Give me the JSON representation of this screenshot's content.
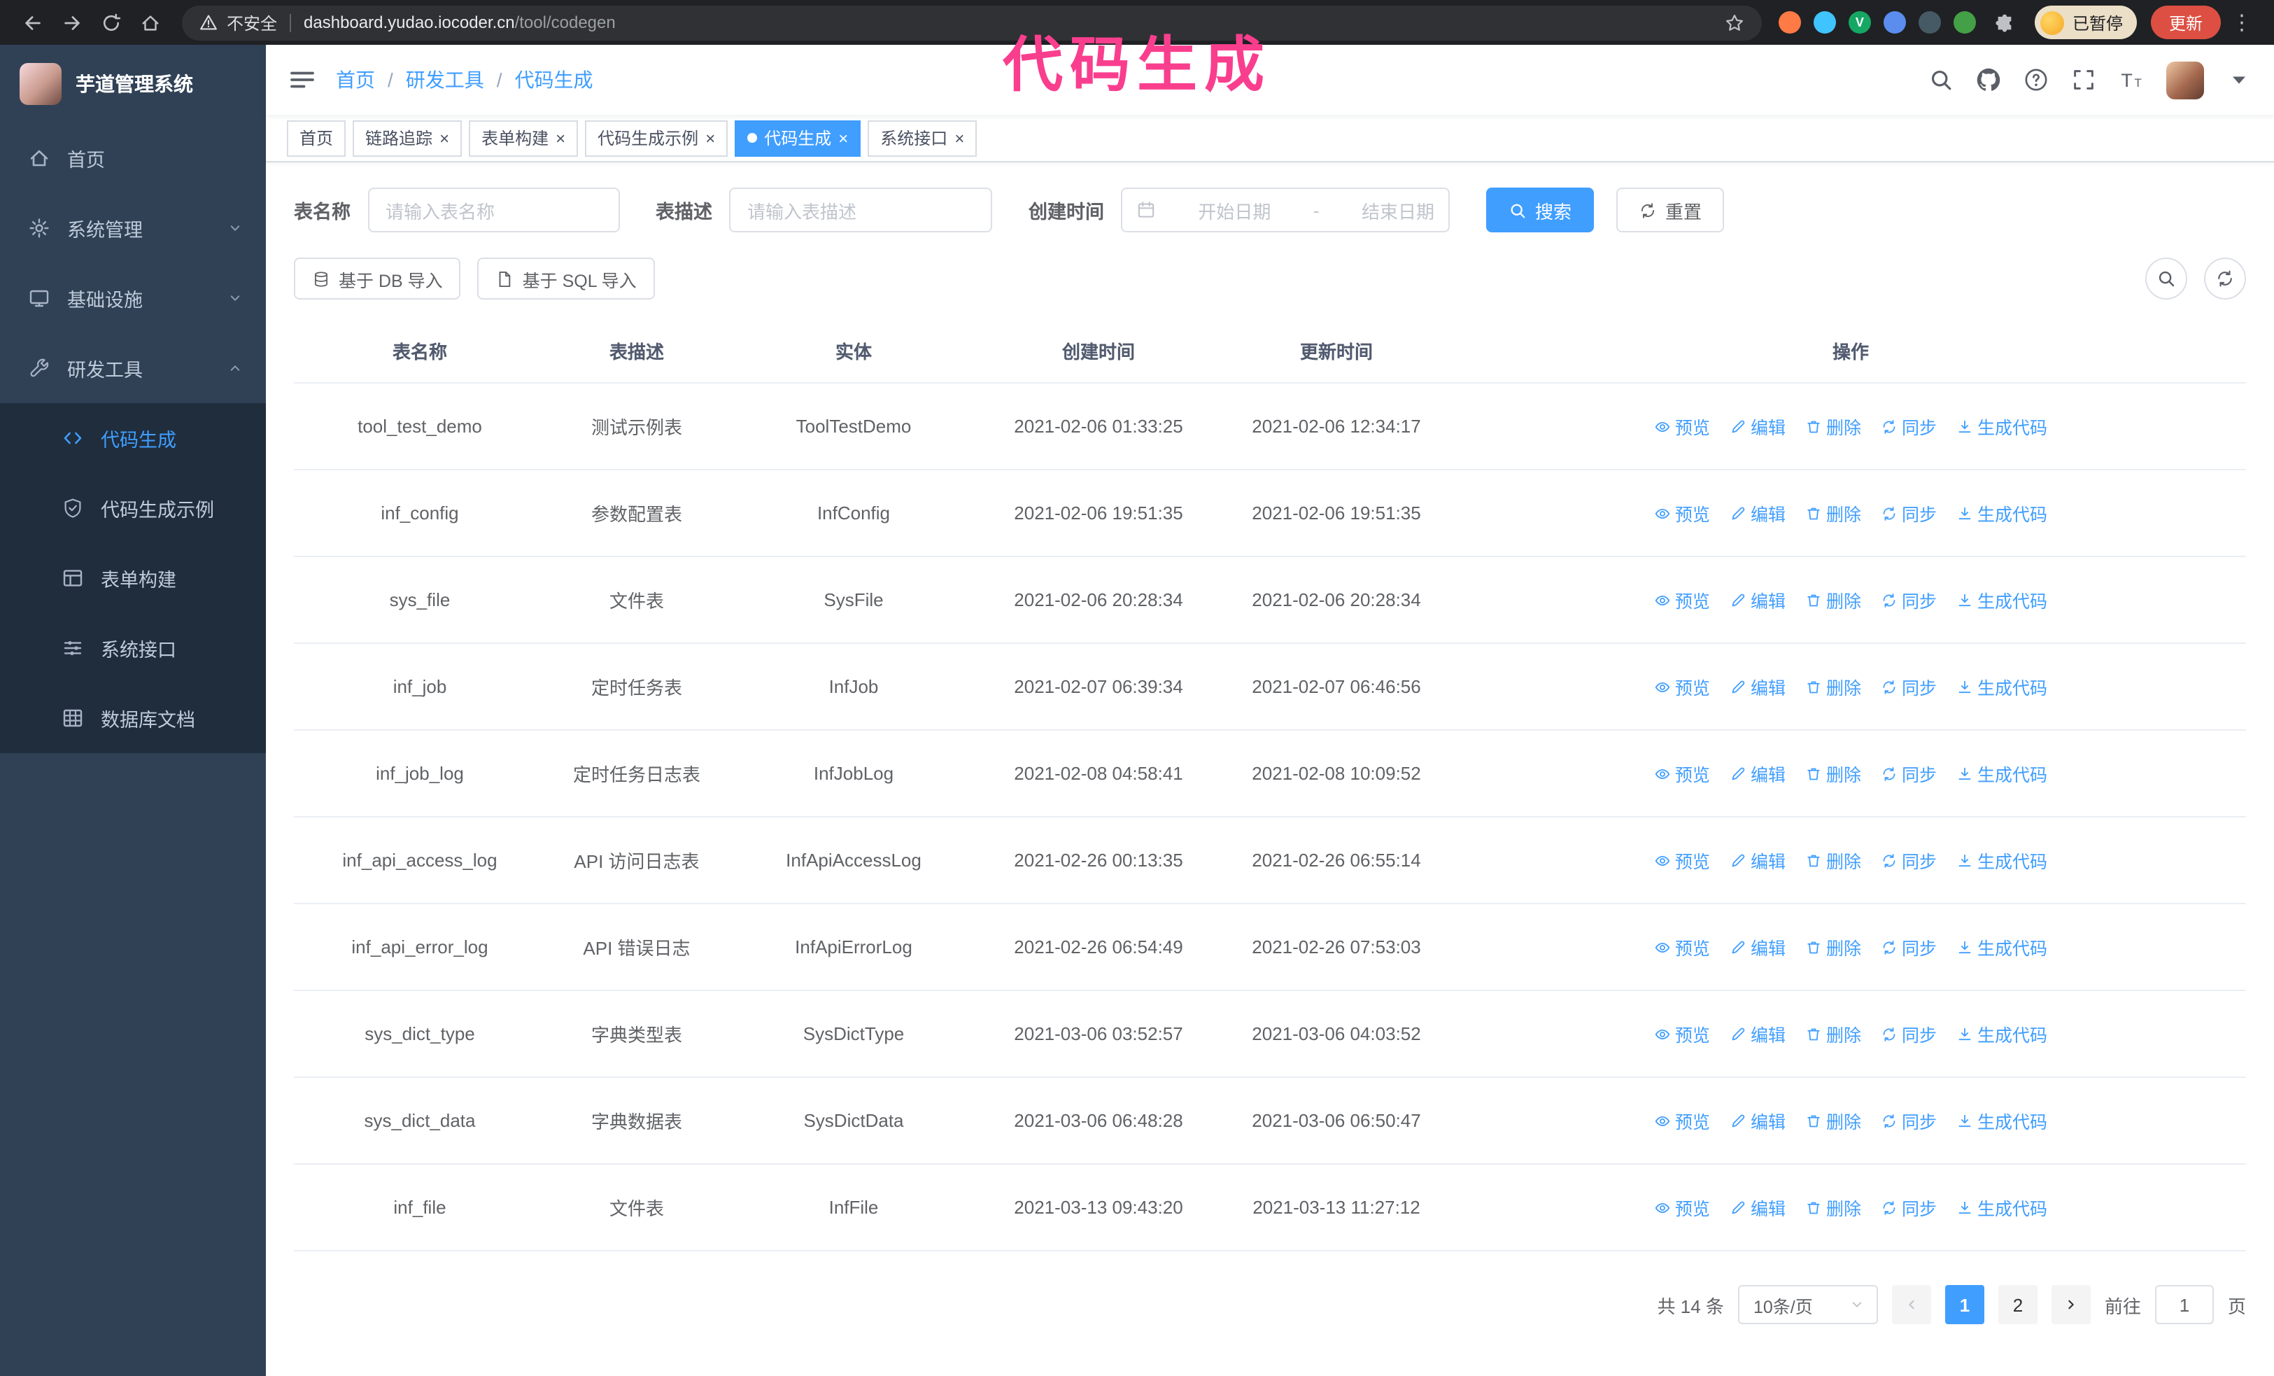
{
  "annotation": {
    "text": "代码生成",
    "color": "#fa3e8e"
  },
  "browser": {
    "security_label": "不安全",
    "url_host": "dashboard.yudao.iocoder.cn",
    "url_path": "/tool/codegen",
    "profile_chip_label": "已暂停",
    "update_button_label": "更新",
    "extensions": [
      {
        "id": "ext-1",
        "color": "#ff7a45",
        "glyph": ""
      },
      {
        "id": "ext-2",
        "color": "#40c4ff",
        "glyph": ""
      },
      {
        "id": "ext-3",
        "color": "#16a765",
        "glyph": "V"
      },
      {
        "id": "ext-4",
        "color": "#5b8def",
        "glyph": ""
      },
      {
        "id": "ext-5",
        "color": "#455a64",
        "glyph": ""
      },
      {
        "id": "ext-6",
        "color": "#43a047",
        "glyph": ""
      }
    ]
  },
  "sidebar": {
    "app_title": "芋道管理系统",
    "items": [
      {
        "id": "home",
        "label": "首页",
        "icon": "home-icon",
        "type": "item",
        "expanded": false
      },
      {
        "id": "system",
        "label": "系统管理",
        "icon": "gear-icon",
        "type": "group",
        "expanded": false
      },
      {
        "id": "infra",
        "label": "基础设施",
        "icon": "monitor-icon",
        "type": "group",
        "expanded": false
      },
      {
        "id": "devtools",
        "label": "研发工具",
        "icon": "wrench-icon",
        "type": "group",
        "expanded": true
      }
    ],
    "submenu": [
      {
        "id": "codegen",
        "label": "代码生成",
        "icon": "code-icon",
        "active": true
      },
      {
        "id": "codegen-example",
        "label": "代码生成示例",
        "icon": "shield-check-icon",
        "active": false
      },
      {
        "id": "form-builder",
        "label": "表单构建",
        "icon": "form-icon",
        "active": false
      },
      {
        "id": "system-api",
        "label": "系统接口",
        "icon": "sliders-icon",
        "active": false
      },
      {
        "id": "db-doc",
        "label": "数据库文档",
        "icon": "grid-icon",
        "active": false
      }
    ]
  },
  "header": {
    "breadcrumb": [
      "首页",
      "研发工具",
      "代码生成"
    ]
  },
  "tabs": [
    {
      "id": "home",
      "label": "首页",
      "closable": false,
      "active": false
    },
    {
      "id": "tracer",
      "label": "链路追踪",
      "closable": true,
      "active": false
    },
    {
      "id": "form-builder",
      "label": "表单构建",
      "closable": true,
      "active": false
    },
    {
      "id": "codegen-example",
      "label": "代码生成示例",
      "closable": true,
      "active": false
    },
    {
      "id": "codegen",
      "label": "代码生成",
      "closable": true,
      "active": true
    },
    {
      "id": "system-api",
      "label": "系统接口",
      "closable": true,
      "active": false
    }
  ],
  "filters": {
    "table_name_label": "表名称",
    "table_name_placeholder": "请输入表名称",
    "table_desc_label": "表描述",
    "table_desc_placeholder": "请输入表描述",
    "create_time_label": "创建时间",
    "date_start_placeholder": "开始日期",
    "date_separator": "-",
    "date_end_placeholder": "结束日期",
    "search_button_label": "搜索",
    "reset_button_label": "重置"
  },
  "toolbar": {
    "import_db_label": "基于 DB 导入",
    "import_sql_label": "基于 SQL 导入"
  },
  "table": {
    "columns": [
      "表名称",
      "表描述",
      "实体",
      "创建时间",
      "更新时间",
      "操作"
    ],
    "actions": [
      {
        "id": "preview",
        "label": "预览",
        "icon": "eye-icon"
      },
      {
        "id": "edit",
        "label": "编辑",
        "icon": "edit-icon"
      },
      {
        "id": "delete",
        "label": "删除",
        "icon": "delete-icon"
      },
      {
        "id": "sync",
        "label": "同步",
        "icon": "sync-icon"
      },
      {
        "id": "generate",
        "label": "生成代码",
        "icon": "download-icon"
      }
    ],
    "rows": [
      {
        "name": "tool_test_demo",
        "desc": "测试示例表",
        "entity": "ToolTestDemo",
        "created": "2021-02-06 01:33:25",
        "updated": "2021-02-06 12:34:17"
      },
      {
        "name": "inf_config",
        "desc": "参数配置表",
        "entity": "InfConfig",
        "created": "2021-02-06 19:51:35",
        "updated": "2021-02-06 19:51:35"
      },
      {
        "name": "sys_file",
        "desc": "文件表",
        "entity": "SysFile",
        "created": "2021-02-06 20:28:34",
        "updated": "2021-02-06 20:28:34"
      },
      {
        "name": "inf_job",
        "desc": "定时任务表",
        "entity": "InfJob",
        "created": "2021-02-07 06:39:34",
        "updated": "2021-02-07 06:46:56"
      },
      {
        "name": "inf_job_log",
        "desc": "定时任务日志表",
        "entity": "InfJobLog",
        "created": "2021-02-08 04:58:41",
        "updated": "2021-02-08 10:09:52"
      },
      {
        "name": "inf_api_access_log",
        "desc": "API 访问日志表",
        "entity": "InfApiAccessLog",
        "created": "2021-02-26 00:13:35",
        "updated": "2021-02-26 06:55:14"
      },
      {
        "name": "inf_api_error_log",
        "desc": "API 错误日志",
        "entity": "InfApiErrorLog",
        "created": "2021-02-26 06:54:49",
        "updated": "2021-02-26 07:53:03"
      },
      {
        "name": "sys_dict_type",
        "desc": "字典类型表",
        "entity": "SysDictType",
        "created": "2021-03-06 03:52:57",
        "updated": "2021-03-06 04:03:52"
      },
      {
        "name": "sys_dict_data",
        "desc": "字典数据表",
        "entity": "SysDictData",
        "created": "2021-03-06 06:48:28",
        "updated": "2021-03-06 06:50:47"
      },
      {
        "name": "inf_file",
        "desc": "文件表",
        "entity": "InfFile",
        "created": "2021-03-13 09:43:20",
        "updated": "2021-03-13 11:27:12"
      }
    ]
  },
  "pagination": {
    "total_label": "共 14 条",
    "page_size_label": "10条/页",
    "pages": [
      "1",
      "2"
    ],
    "active_page": "1",
    "goto_label": "前往",
    "goto_value": "1",
    "goto_suffix": "页"
  }
}
